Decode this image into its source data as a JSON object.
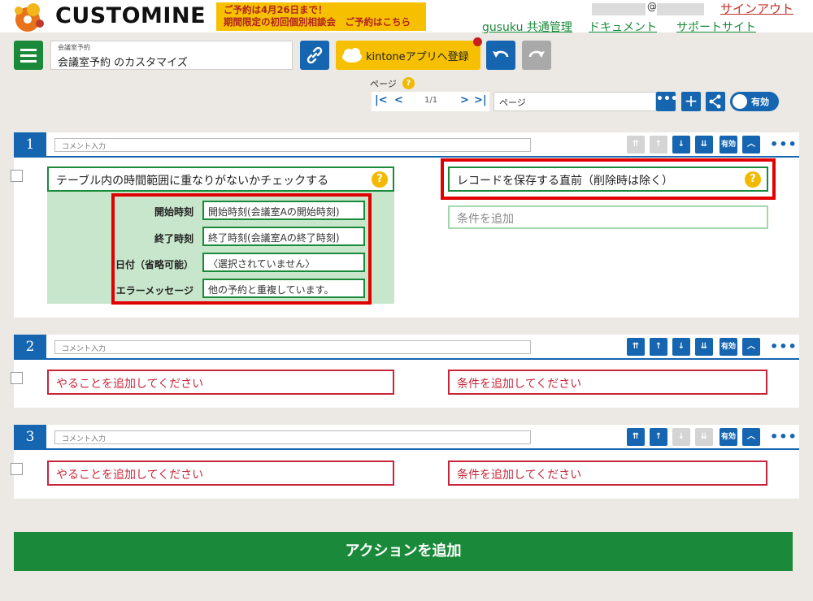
{
  "header": {
    "logo_text": "CUSTOMINE",
    "promo_line1": "ご予約は4月26日まで！",
    "promo_line2": "期間限定の初回個別相談会　ご予約はこちら",
    "user_at": "@",
    "signout": "サインアウト",
    "links": [
      "gusuku 共通管理",
      "ドキュメント",
      "サポートサイト"
    ]
  },
  "toolbar": {
    "app_sublabel": "会議室予約",
    "app_name": "会議室予約 のカスタマイズ",
    "kintone_button": "kintoneアプリへ登録"
  },
  "pager": {
    "label": "ページ",
    "help": "?",
    "page_number": "1/1",
    "page_input": "ページ",
    "toggle_label": "有効"
  },
  "actions": [
    {
      "number": "1",
      "comment_placeholder": "コメント入力",
      "enabled_label": "有効",
      "do_title": "テーブル内の時間範囲に重なりがないかチェックする",
      "condition_title": "レコードを保存する直前（削除時は除く）",
      "add_condition": "条件を追加",
      "params": [
        {
          "label": "開始時刻",
          "value": "開始時刻(会議室Aの開始時刻)"
        },
        {
          "label": "終了時刻",
          "value": "終了時刻(会議室Aの終了時刻)"
        },
        {
          "label": "日付（省略可能）",
          "value": "〈選択されていません〉"
        },
        {
          "label": "エラーメッセージ",
          "value": "他の予約と重複しています。"
        }
      ]
    },
    {
      "number": "2",
      "comment_placeholder": "コメント入力",
      "enabled_label": "有効",
      "do_placeholder": "やることを追加してください",
      "condition_placeholder": "条件を追加してください"
    },
    {
      "number": "3",
      "comment_placeholder": "コメント入力",
      "enabled_label": "有効",
      "do_placeholder": "やることを追加してください",
      "condition_placeholder": "条件を追加してください"
    }
  ],
  "add_action": "アクションを追加",
  "colors": {
    "brand_green": "#1a8a3a",
    "accent_blue": "#1565b0",
    "warning_red": "#c8253a",
    "promo_yellow": "#f6c000"
  }
}
